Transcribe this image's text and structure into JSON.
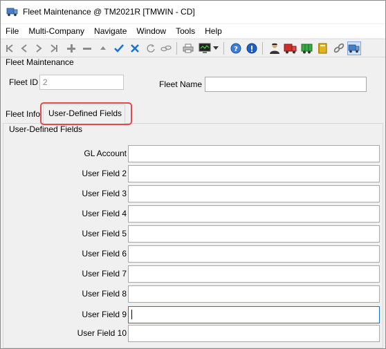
{
  "window": {
    "title": "Fleet Maintenance @ TM2021R [TMWIN - CD]"
  },
  "menu": [
    "File",
    "Multi-Company",
    "Navigate",
    "Window",
    "Tools",
    "Help"
  ],
  "toolbar": {
    "icons": [
      "first-icon",
      "previous-icon",
      "next-icon",
      "last-icon",
      "add-icon",
      "delete-icon",
      "up-icon",
      "save-check-icon",
      "cancel-x-icon",
      "refresh-icon",
      "link-icon",
      "print-icon",
      "monitor-icon",
      "dropdown-arrow-icon",
      "help-icon",
      "info-icon",
      "driver-icon",
      "truck-icon",
      "trailer-icon",
      "book-icon",
      "chain-icon",
      "fleet-truck-icon"
    ]
  },
  "header": {
    "group_label": "Fleet Maintenance",
    "fleet_id_label": "Fleet ID",
    "fleet_id_value": "2",
    "fleet_name_label": "Fleet Name",
    "fleet_name_value": ""
  },
  "tabs": [
    {
      "label": "Fleet Info",
      "active": false
    },
    {
      "label": "User-Defined Fields",
      "active": true
    }
  ],
  "udf": {
    "group_label": "User-Defined Fields",
    "fields": [
      {
        "label": "GL Account",
        "value": ""
      },
      {
        "label": "User Field 2",
        "value": ""
      },
      {
        "label": "User Field 3",
        "value": ""
      },
      {
        "label": "User Field 4",
        "value": ""
      },
      {
        "label": "User Field 5",
        "value": ""
      },
      {
        "label": "User Field 6",
        "value": ""
      },
      {
        "label": "User Field 7",
        "value": ""
      },
      {
        "label": "User Field 8",
        "value": ""
      },
      {
        "label": "User Field 9",
        "value": ""
      },
      {
        "label": "User Field 10",
        "value": ""
      }
    ]
  },
  "colors": {
    "highlight": "#e8474a",
    "accent_blue": "#1a73d9"
  }
}
